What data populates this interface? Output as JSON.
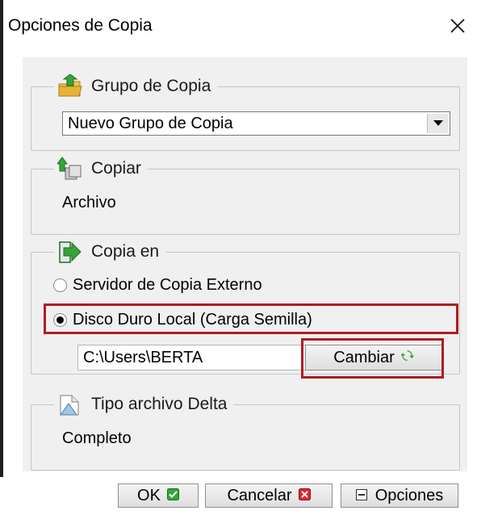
{
  "window": {
    "title": "Opciones de Copia"
  },
  "backup_group": {
    "legend": "Grupo de Copia",
    "selected": "Nuevo Grupo de Copia"
  },
  "copy": {
    "legend": "Copiar",
    "value": "Archivo"
  },
  "copy_to": {
    "legend": "Copia en",
    "options": [
      {
        "label": "Servidor de Copia  Externo",
        "selected": false
      },
      {
        "label": "Disco Duro Local (Carga Semilla)",
        "selected": true
      }
    ],
    "path": "C:\\Users\\BERTA",
    "change_label": "Cambiar"
  },
  "delta": {
    "legend": "Tipo archivo Delta",
    "value": "Completo"
  },
  "footer": {
    "ok_label": "OK",
    "cancel_label": "Cancelar",
    "options_label": "Opciones"
  },
  "colors": {
    "highlight": "#b01c22",
    "dialog_bg": "#f0f0f0",
    "icon_green": "#2f9e2f"
  }
}
